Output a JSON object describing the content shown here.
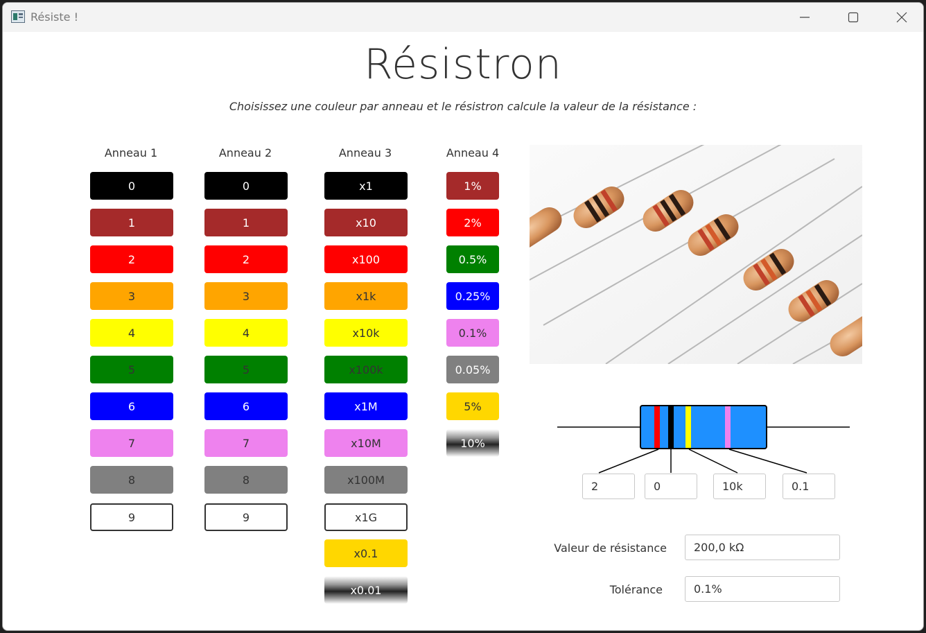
{
  "window": {
    "title": "Résiste !"
  },
  "header": {
    "title": "Résistron",
    "subtitle": "Choisissez une couleur par anneau et le résistron calcule la valeur de la résistance :"
  },
  "rings": [
    {
      "label": "Anneau 1",
      "buttons": [
        {
          "label": "0",
          "color": "#000000",
          "text_color": "#ffffff"
        },
        {
          "label": "1",
          "color": "#a52a2a",
          "text_color": "#ffffff"
        },
        {
          "label": "2",
          "color": "#ff0000",
          "text_color": "#ffffff"
        },
        {
          "label": "3",
          "color": "#ffa500",
          "text_color": "#333333"
        },
        {
          "label": "4",
          "color": "#ffff00",
          "text_color": "#333333"
        },
        {
          "label": "5",
          "color": "#008000",
          "text_color": "#333333"
        },
        {
          "label": "6",
          "color": "#0000ff",
          "text_color": "#ffffff"
        },
        {
          "label": "7",
          "color": "#ee82ee",
          "text_color": "#333333"
        },
        {
          "label": "8",
          "color": "#808080",
          "text_color": "#333333"
        },
        {
          "label": "9",
          "color": "#ffffff",
          "text_color": "#333333",
          "outline": true
        }
      ]
    },
    {
      "label": "Anneau 2",
      "buttons": [
        {
          "label": "0",
          "color": "#000000",
          "text_color": "#ffffff"
        },
        {
          "label": "1",
          "color": "#a52a2a",
          "text_color": "#ffffff"
        },
        {
          "label": "2",
          "color": "#ff0000",
          "text_color": "#ffffff"
        },
        {
          "label": "3",
          "color": "#ffa500",
          "text_color": "#333333"
        },
        {
          "label": "4",
          "color": "#ffff00",
          "text_color": "#333333"
        },
        {
          "label": "5",
          "color": "#008000",
          "text_color": "#333333"
        },
        {
          "label": "6",
          "color": "#0000ff",
          "text_color": "#ffffff"
        },
        {
          "label": "7",
          "color": "#ee82ee",
          "text_color": "#333333"
        },
        {
          "label": "8",
          "color": "#808080",
          "text_color": "#333333"
        },
        {
          "label": "9",
          "color": "#ffffff",
          "text_color": "#333333",
          "outline": true
        }
      ]
    },
    {
      "label": "Anneau 3",
      "buttons": [
        {
          "label": "x1",
          "color": "#000000",
          "text_color": "#ffffff"
        },
        {
          "label": "x10",
          "color": "#a52a2a",
          "text_color": "#ffffff"
        },
        {
          "label": "x100",
          "color": "#ff0000",
          "text_color": "#ffffff"
        },
        {
          "label": "x1k",
          "color": "#ffa500",
          "text_color": "#333333"
        },
        {
          "label": "x10k",
          "color": "#ffff00",
          "text_color": "#333333"
        },
        {
          "label": "x100k",
          "color": "#008000",
          "text_color": "#333333"
        },
        {
          "label": "x1M",
          "color": "#0000ff",
          "text_color": "#ffffff"
        },
        {
          "label": "x10M",
          "color": "#ee82ee",
          "text_color": "#333333"
        },
        {
          "label": "x100M",
          "color": "#808080",
          "text_color": "#333333"
        },
        {
          "label": "x1G",
          "color": "#ffffff",
          "text_color": "#333333",
          "outline": true
        },
        {
          "label": "x0.1",
          "color": "#ffd700",
          "text_color": "#333333"
        },
        {
          "label": "x0.01",
          "color": "silver",
          "text_color": "#ffffff",
          "silver": true
        }
      ]
    },
    {
      "label": "Anneau 4",
      "buttons": [
        {
          "label": "1%",
          "color": "#a52a2a",
          "text_color": "#ffffff"
        },
        {
          "label": "2%",
          "color": "#ff0000",
          "text_color": "#ffffff"
        },
        {
          "label": "0.5%",
          "color": "#008000",
          "text_color": "#ffffff"
        },
        {
          "label": "0.25%",
          "color": "#0000ff",
          "text_color": "#ffffff"
        },
        {
          "label": "0.1%",
          "color": "#ee82ee",
          "text_color": "#333333"
        },
        {
          "label": "0.05%",
          "color": "#808080",
          "text_color": "#ffffff"
        },
        {
          "label": "5%",
          "color": "#ffd700",
          "text_color": "#333333"
        },
        {
          "label": "10%",
          "color": "silver",
          "text_color": "#ffffff",
          "silver": true
        }
      ]
    }
  ],
  "resistor": {
    "body_color": "#1e90ff",
    "band_colors": [
      "#ff0000",
      "#000000",
      "#ffff00",
      "#ee82ee"
    ],
    "fields": [
      "2",
      "0",
      "10k",
      "0.1"
    ]
  },
  "results": {
    "resistance_label": "Valeur de résistance",
    "resistance_value": "200,0 kΩ",
    "tolerance_label": "Tolérance",
    "tolerance_value": "0.1%"
  }
}
